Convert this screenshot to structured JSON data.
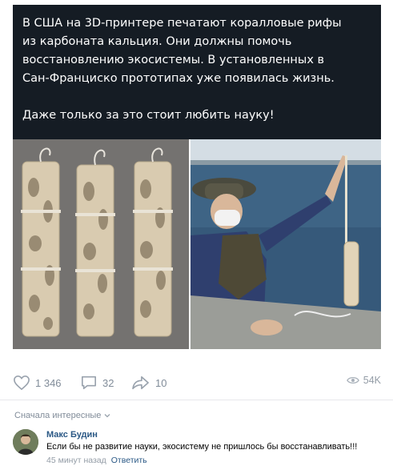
{
  "post": {
    "lines": [
      "В США на 3D-принтере печатают коралловые рифы",
      "из карбоната кальция. Они должны помочь",
      "восстановлению экосистемы. В установленных в",
      "Сан-Франциско прототипах уже появилась жизнь."
    ],
    "tagline": "Даже только за это стоит любить науку!"
  },
  "actions": {
    "likes": "1 346",
    "comments": "32",
    "shares": "10",
    "views": "54K"
  },
  "comments_section": {
    "sort_label": "Сначала интересные"
  },
  "comment": {
    "author": "Макс Будин",
    "text": "Если бы не развитие науки, экосистему не пришлось бы восстанавливать!!!",
    "time": "45 минут назад",
    "reply_label": "Ответить"
  }
}
